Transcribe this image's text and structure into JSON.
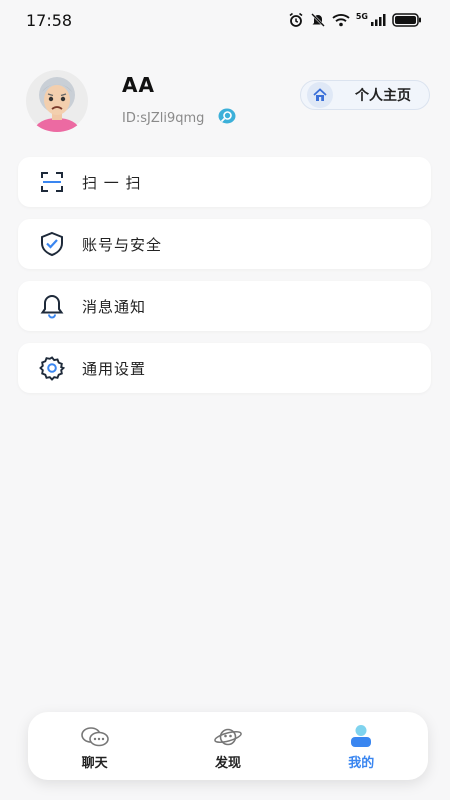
{
  "status_bar": {
    "time": "17:58",
    "network": "5G",
    "icons": [
      "alarm-icon",
      "mute-icon",
      "wifi-icon",
      "signal-icon",
      "battery-icon"
    ]
  },
  "profile": {
    "name": "AA",
    "id_text": "ID:sJZli9qmg",
    "home_button_label": "个人主页"
  },
  "menu": {
    "items": [
      {
        "label": "扫 一 扫",
        "icon": "scan-icon"
      },
      {
        "label": "账号与安全",
        "icon": "shield-check-icon"
      },
      {
        "label": "消息通知",
        "icon": "bell-icon"
      },
      {
        "label": "通用设置",
        "icon": "gear-icon"
      }
    ]
  },
  "nav": {
    "tabs": [
      {
        "label": "聊天",
        "icon": "chat-icon",
        "active": false
      },
      {
        "label": "发现",
        "icon": "planet-icon",
        "active": false
      },
      {
        "label": "我的",
        "icon": "user-icon",
        "active": true
      }
    ]
  },
  "colors": {
    "accent": "#3a86f0",
    "background": "#f7f7f8",
    "card": "#ffffff"
  }
}
